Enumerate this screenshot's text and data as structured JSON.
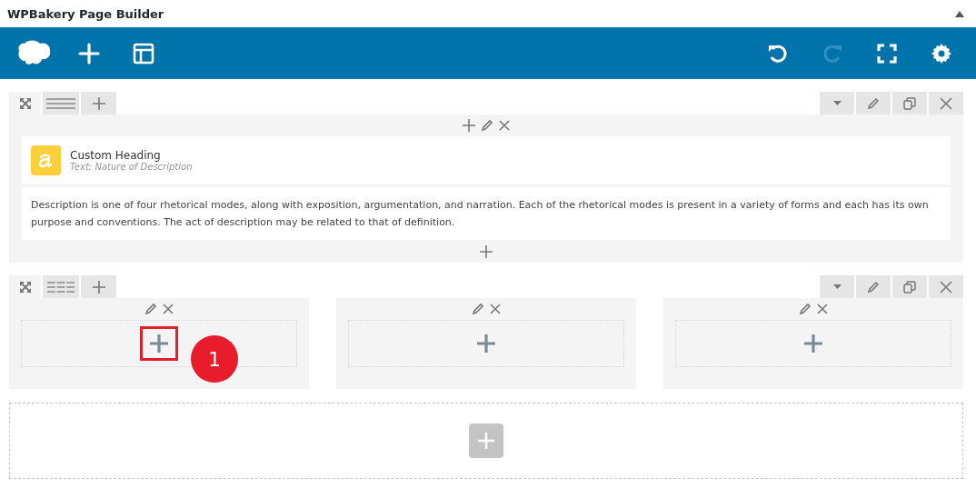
{
  "panel": {
    "title": "WPBakery Page Builder",
    "collapsed": false
  },
  "toolbar": {
    "left": [
      {
        "kind": "logo"
      },
      {
        "kind": "add"
      },
      {
        "kind": "templates"
      }
    ],
    "right": [
      {
        "kind": "undo",
        "disabled": false
      },
      {
        "kind": "redo",
        "disabled": true
      },
      {
        "kind": "fullscreen",
        "disabled": false
      },
      {
        "kind": "settings",
        "disabled": false
      }
    ]
  },
  "rows": [
    {
      "kind": "content",
      "elements": [
        {
          "kind": "heading",
          "title": "Custom Heading",
          "subtitle": "Text: Nature of Description"
        },
        {
          "kind": "text",
          "text": "Description is one of four rhetorical modes, along with exposition, argumentation, and narration. Each of the rhetorical modes is present in a variety of forms and each has its own purpose and conventions. The act of description may be related to that of definition."
        }
      ]
    },
    {
      "kind": "columns",
      "cells": [
        {
          "highlighted": true,
          "badge": "1"
        },
        {
          "highlighted": false
        },
        {
          "highlighted": false
        }
      ]
    }
  ]
}
